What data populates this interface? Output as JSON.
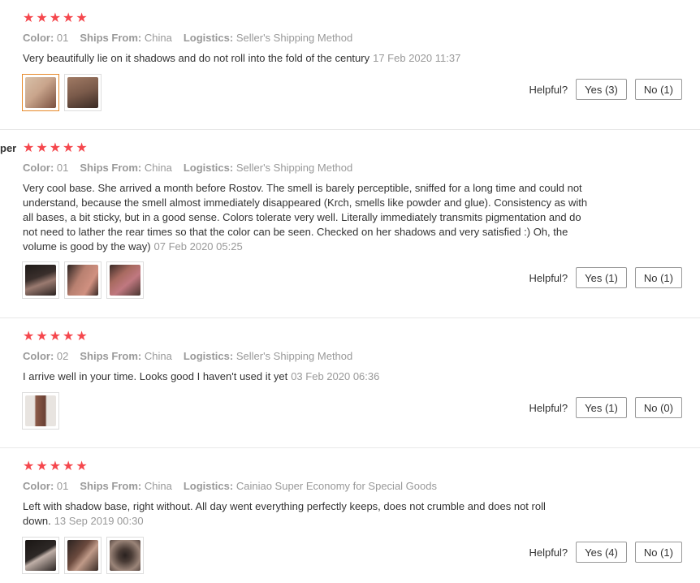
{
  "labels": {
    "color": "Color:",
    "ships_from": "Ships From:",
    "logistics": "Logistics:",
    "helpful": "Helpful?"
  },
  "reviews": [
    {
      "username": "",
      "stars": 5,
      "color": "01",
      "ships_from": "China",
      "logistics": "Seller's Shipping Method",
      "text": "Very beautifully lie on it shadows and do not roll into the fold of the century",
      "date": "17 Feb 2020 11:37",
      "yes_label": "Yes (3)",
      "no_label": "No (1)",
      "photo_colors": [
        "#c9a58c",
        "#7a5a4a"
      ]
    },
    {
      "username": "per",
      "stars": 5,
      "color": "01",
      "ships_from": "China",
      "logistics": "Seller's Shipping Method",
      "text": "Very cool base. She arrived a month before Rostov. The smell is barely perceptible, sniffed for a long time and could not understand, because the smell almost immediately disappeared (Krch, smells like powder and glue). Consistency as with all bases, a bit sticky, but in a good sense. Colors tolerate very well. Literally immediately transmits pigmentation and do not need to lather the rear times so that the color can be seen. Checked on her shadows and very satisfied :) Oh, the volume is good by the way)",
      "date": "07 Feb 2020 05:25",
      "yes_label": "Yes (1)",
      "no_label": "No (1)",
      "photo_colors": [
        "#3a2f2c",
        "#b88070",
        "#a86a60"
      ]
    },
    {
      "username": "",
      "stars": 5,
      "color": "02",
      "ships_from": "China",
      "logistics": "Seller's Shipping Method",
      "text": "I arrive well in your time. Looks good I haven't used it yet",
      "date": "03 Feb 2020 06:36",
      "yes_label": "Yes (1)",
      "no_label": "No (0)",
      "photo_colors": [
        "#8a5a48"
      ]
    },
    {
      "username": "",
      "stars": 5,
      "color": "01",
      "ships_from": "China",
      "logistics": "Cainiao Super Economy for Special Goods",
      "text": "Left with shadow base, right without. All day went everything perfectly keeps, does not crumble and does not roll down.",
      "date": "13 Sep 2019 00:30",
      "yes_label": "Yes (4)",
      "no_label": "No (1)",
      "photo_colors": [
        "#2d2826",
        "#6b4a3e",
        "#4a3c36"
      ]
    }
  ]
}
